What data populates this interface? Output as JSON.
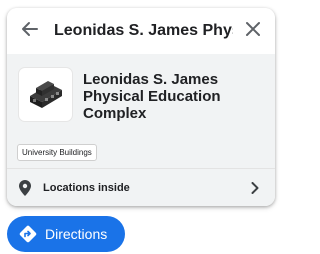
{
  "search": {
    "query": "Leonidas S. James Physical Education Complex",
    "back_icon": "arrow-left-icon",
    "close_icon": "close-icon"
  },
  "place": {
    "title": "Leonidas S. James Physical Education Complex",
    "thumbnail_icon": "building-3d-icon",
    "category": "University Buildings"
  },
  "locations_inside": {
    "label": "Locations inside",
    "icon": "map-pin-icon",
    "chevron_icon": "chevron-right-icon"
  },
  "directions": {
    "label": "Directions",
    "icon": "directions-icon"
  },
  "colors": {
    "accent": "#1a73e8",
    "panel_bg": "#f1f3f4"
  }
}
